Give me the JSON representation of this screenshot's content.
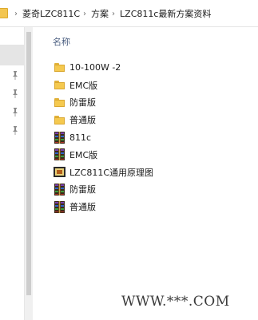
{
  "breadcrumb": {
    "items": [
      "菱奇LZC811C",
      "方案",
      "LZC811c最新方案资料"
    ],
    "separator": "›"
  },
  "content": {
    "column_header": "名称",
    "files": [
      {
        "name": "10-100W -2",
        "type": "folder",
        "icon": "folder-icon"
      },
      {
        "name": "EMC版",
        "type": "folder",
        "icon": "folder-icon"
      },
      {
        "name": "防雷版",
        "type": "folder",
        "icon": "folder-icon"
      },
      {
        "name": "普通版",
        "type": "folder",
        "icon": "folder-icon"
      },
      {
        "name": "811c",
        "type": "archive",
        "icon": "winrar-archive-icon"
      },
      {
        "name": "EMC版",
        "type": "archive",
        "icon": "winrar-archive-icon"
      },
      {
        "name": "LZC811C通用原理图",
        "type": "image",
        "icon": "image-file-icon"
      },
      {
        "name": "防雷版",
        "type": "archive",
        "icon": "winrar-archive-icon"
      },
      {
        "name": "普通版",
        "type": "archive",
        "icon": "winrar-archive-icon"
      }
    ]
  },
  "watermark": "WWW.***.COM",
  "colors": {
    "folder": "#f5c94f",
    "header_text": "#4d6082",
    "selection": "#e5e5e5"
  }
}
